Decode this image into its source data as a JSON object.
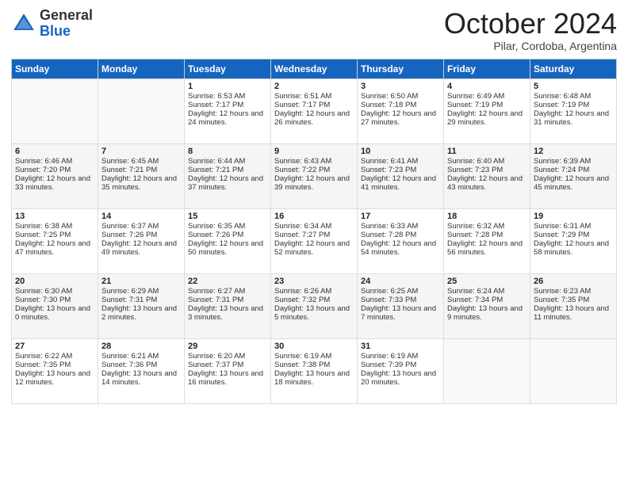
{
  "header": {
    "logo_line1": "General",
    "logo_line2": "Blue",
    "month_title": "October 2024",
    "subtitle": "Pilar, Cordoba, Argentina"
  },
  "calendar": {
    "days": [
      "Sunday",
      "Monday",
      "Tuesday",
      "Wednesday",
      "Thursday",
      "Friday",
      "Saturday"
    ],
    "weeks": [
      [
        {
          "day": "",
          "sunrise": "",
          "sunset": "",
          "daylight": ""
        },
        {
          "day": "",
          "sunrise": "",
          "sunset": "",
          "daylight": ""
        },
        {
          "day": "1",
          "sunrise": "Sunrise: 6:53 AM",
          "sunset": "Sunset: 7:17 PM",
          "daylight": "Daylight: 12 hours and 24 minutes."
        },
        {
          "day": "2",
          "sunrise": "Sunrise: 6:51 AM",
          "sunset": "Sunset: 7:17 PM",
          "daylight": "Daylight: 12 hours and 26 minutes."
        },
        {
          "day": "3",
          "sunrise": "Sunrise: 6:50 AM",
          "sunset": "Sunset: 7:18 PM",
          "daylight": "Daylight: 12 hours and 27 minutes."
        },
        {
          "day": "4",
          "sunrise": "Sunrise: 6:49 AM",
          "sunset": "Sunset: 7:19 PM",
          "daylight": "Daylight: 12 hours and 29 minutes."
        },
        {
          "day": "5",
          "sunrise": "Sunrise: 6:48 AM",
          "sunset": "Sunset: 7:19 PM",
          "daylight": "Daylight: 12 hours and 31 minutes."
        }
      ],
      [
        {
          "day": "6",
          "sunrise": "Sunrise: 6:46 AM",
          "sunset": "Sunset: 7:20 PM",
          "daylight": "Daylight: 12 hours and 33 minutes."
        },
        {
          "day": "7",
          "sunrise": "Sunrise: 6:45 AM",
          "sunset": "Sunset: 7:21 PM",
          "daylight": "Daylight: 12 hours and 35 minutes."
        },
        {
          "day": "8",
          "sunrise": "Sunrise: 6:44 AM",
          "sunset": "Sunset: 7:21 PM",
          "daylight": "Daylight: 12 hours and 37 minutes."
        },
        {
          "day": "9",
          "sunrise": "Sunrise: 6:43 AM",
          "sunset": "Sunset: 7:22 PM",
          "daylight": "Daylight: 12 hours and 39 minutes."
        },
        {
          "day": "10",
          "sunrise": "Sunrise: 6:41 AM",
          "sunset": "Sunset: 7:23 PM",
          "daylight": "Daylight: 12 hours and 41 minutes."
        },
        {
          "day": "11",
          "sunrise": "Sunrise: 6:40 AM",
          "sunset": "Sunset: 7:23 PM",
          "daylight": "Daylight: 12 hours and 43 minutes."
        },
        {
          "day": "12",
          "sunrise": "Sunrise: 6:39 AM",
          "sunset": "Sunset: 7:24 PM",
          "daylight": "Daylight: 12 hours and 45 minutes."
        }
      ],
      [
        {
          "day": "13",
          "sunrise": "Sunrise: 6:38 AM",
          "sunset": "Sunset: 7:25 PM",
          "daylight": "Daylight: 12 hours and 47 minutes."
        },
        {
          "day": "14",
          "sunrise": "Sunrise: 6:37 AM",
          "sunset": "Sunset: 7:26 PM",
          "daylight": "Daylight: 12 hours and 49 minutes."
        },
        {
          "day": "15",
          "sunrise": "Sunrise: 6:35 AM",
          "sunset": "Sunset: 7:26 PM",
          "daylight": "Daylight: 12 hours and 50 minutes."
        },
        {
          "day": "16",
          "sunrise": "Sunrise: 6:34 AM",
          "sunset": "Sunset: 7:27 PM",
          "daylight": "Daylight: 12 hours and 52 minutes."
        },
        {
          "day": "17",
          "sunrise": "Sunrise: 6:33 AM",
          "sunset": "Sunset: 7:28 PM",
          "daylight": "Daylight: 12 hours and 54 minutes."
        },
        {
          "day": "18",
          "sunrise": "Sunrise: 6:32 AM",
          "sunset": "Sunset: 7:28 PM",
          "daylight": "Daylight: 12 hours and 56 minutes."
        },
        {
          "day": "19",
          "sunrise": "Sunrise: 6:31 AM",
          "sunset": "Sunset: 7:29 PM",
          "daylight": "Daylight: 12 hours and 58 minutes."
        }
      ],
      [
        {
          "day": "20",
          "sunrise": "Sunrise: 6:30 AM",
          "sunset": "Sunset: 7:30 PM",
          "daylight": "Daylight: 13 hours and 0 minutes."
        },
        {
          "day": "21",
          "sunrise": "Sunrise: 6:29 AM",
          "sunset": "Sunset: 7:31 PM",
          "daylight": "Daylight: 13 hours and 2 minutes."
        },
        {
          "day": "22",
          "sunrise": "Sunrise: 6:27 AM",
          "sunset": "Sunset: 7:31 PM",
          "daylight": "Daylight: 13 hours and 3 minutes."
        },
        {
          "day": "23",
          "sunrise": "Sunrise: 6:26 AM",
          "sunset": "Sunset: 7:32 PM",
          "daylight": "Daylight: 13 hours and 5 minutes."
        },
        {
          "day": "24",
          "sunrise": "Sunrise: 6:25 AM",
          "sunset": "Sunset: 7:33 PM",
          "daylight": "Daylight: 13 hours and 7 minutes."
        },
        {
          "day": "25",
          "sunrise": "Sunrise: 6:24 AM",
          "sunset": "Sunset: 7:34 PM",
          "daylight": "Daylight: 13 hours and 9 minutes."
        },
        {
          "day": "26",
          "sunrise": "Sunrise: 6:23 AM",
          "sunset": "Sunset: 7:35 PM",
          "daylight": "Daylight: 13 hours and 11 minutes."
        }
      ],
      [
        {
          "day": "27",
          "sunrise": "Sunrise: 6:22 AM",
          "sunset": "Sunset: 7:35 PM",
          "daylight": "Daylight: 13 hours and 12 minutes."
        },
        {
          "day": "28",
          "sunrise": "Sunrise: 6:21 AM",
          "sunset": "Sunset: 7:36 PM",
          "daylight": "Daylight: 13 hours and 14 minutes."
        },
        {
          "day": "29",
          "sunrise": "Sunrise: 6:20 AM",
          "sunset": "Sunset: 7:37 PM",
          "daylight": "Daylight: 13 hours and 16 minutes."
        },
        {
          "day": "30",
          "sunrise": "Sunrise: 6:19 AM",
          "sunset": "Sunset: 7:38 PM",
          "daylight": "Daylight: 13 hours and 18 minutes."
        },
        {
          "day": "31",
          "sunrise": "Sunrise: 6:19 AM",
          "sunset": "Sunset: 7:39 PM",
          "daylight": "Daylight: 13 hours and 20 minutes."
        },
        {
          "day": "",
          "sunrise": "",
          "sunset": "",
          "daylight": ""
        },
        {
          "day": "",
          "sunrise": "",
          "sunset": "",
          "daylight": ""
        }
      ]
    ]
  }
}
